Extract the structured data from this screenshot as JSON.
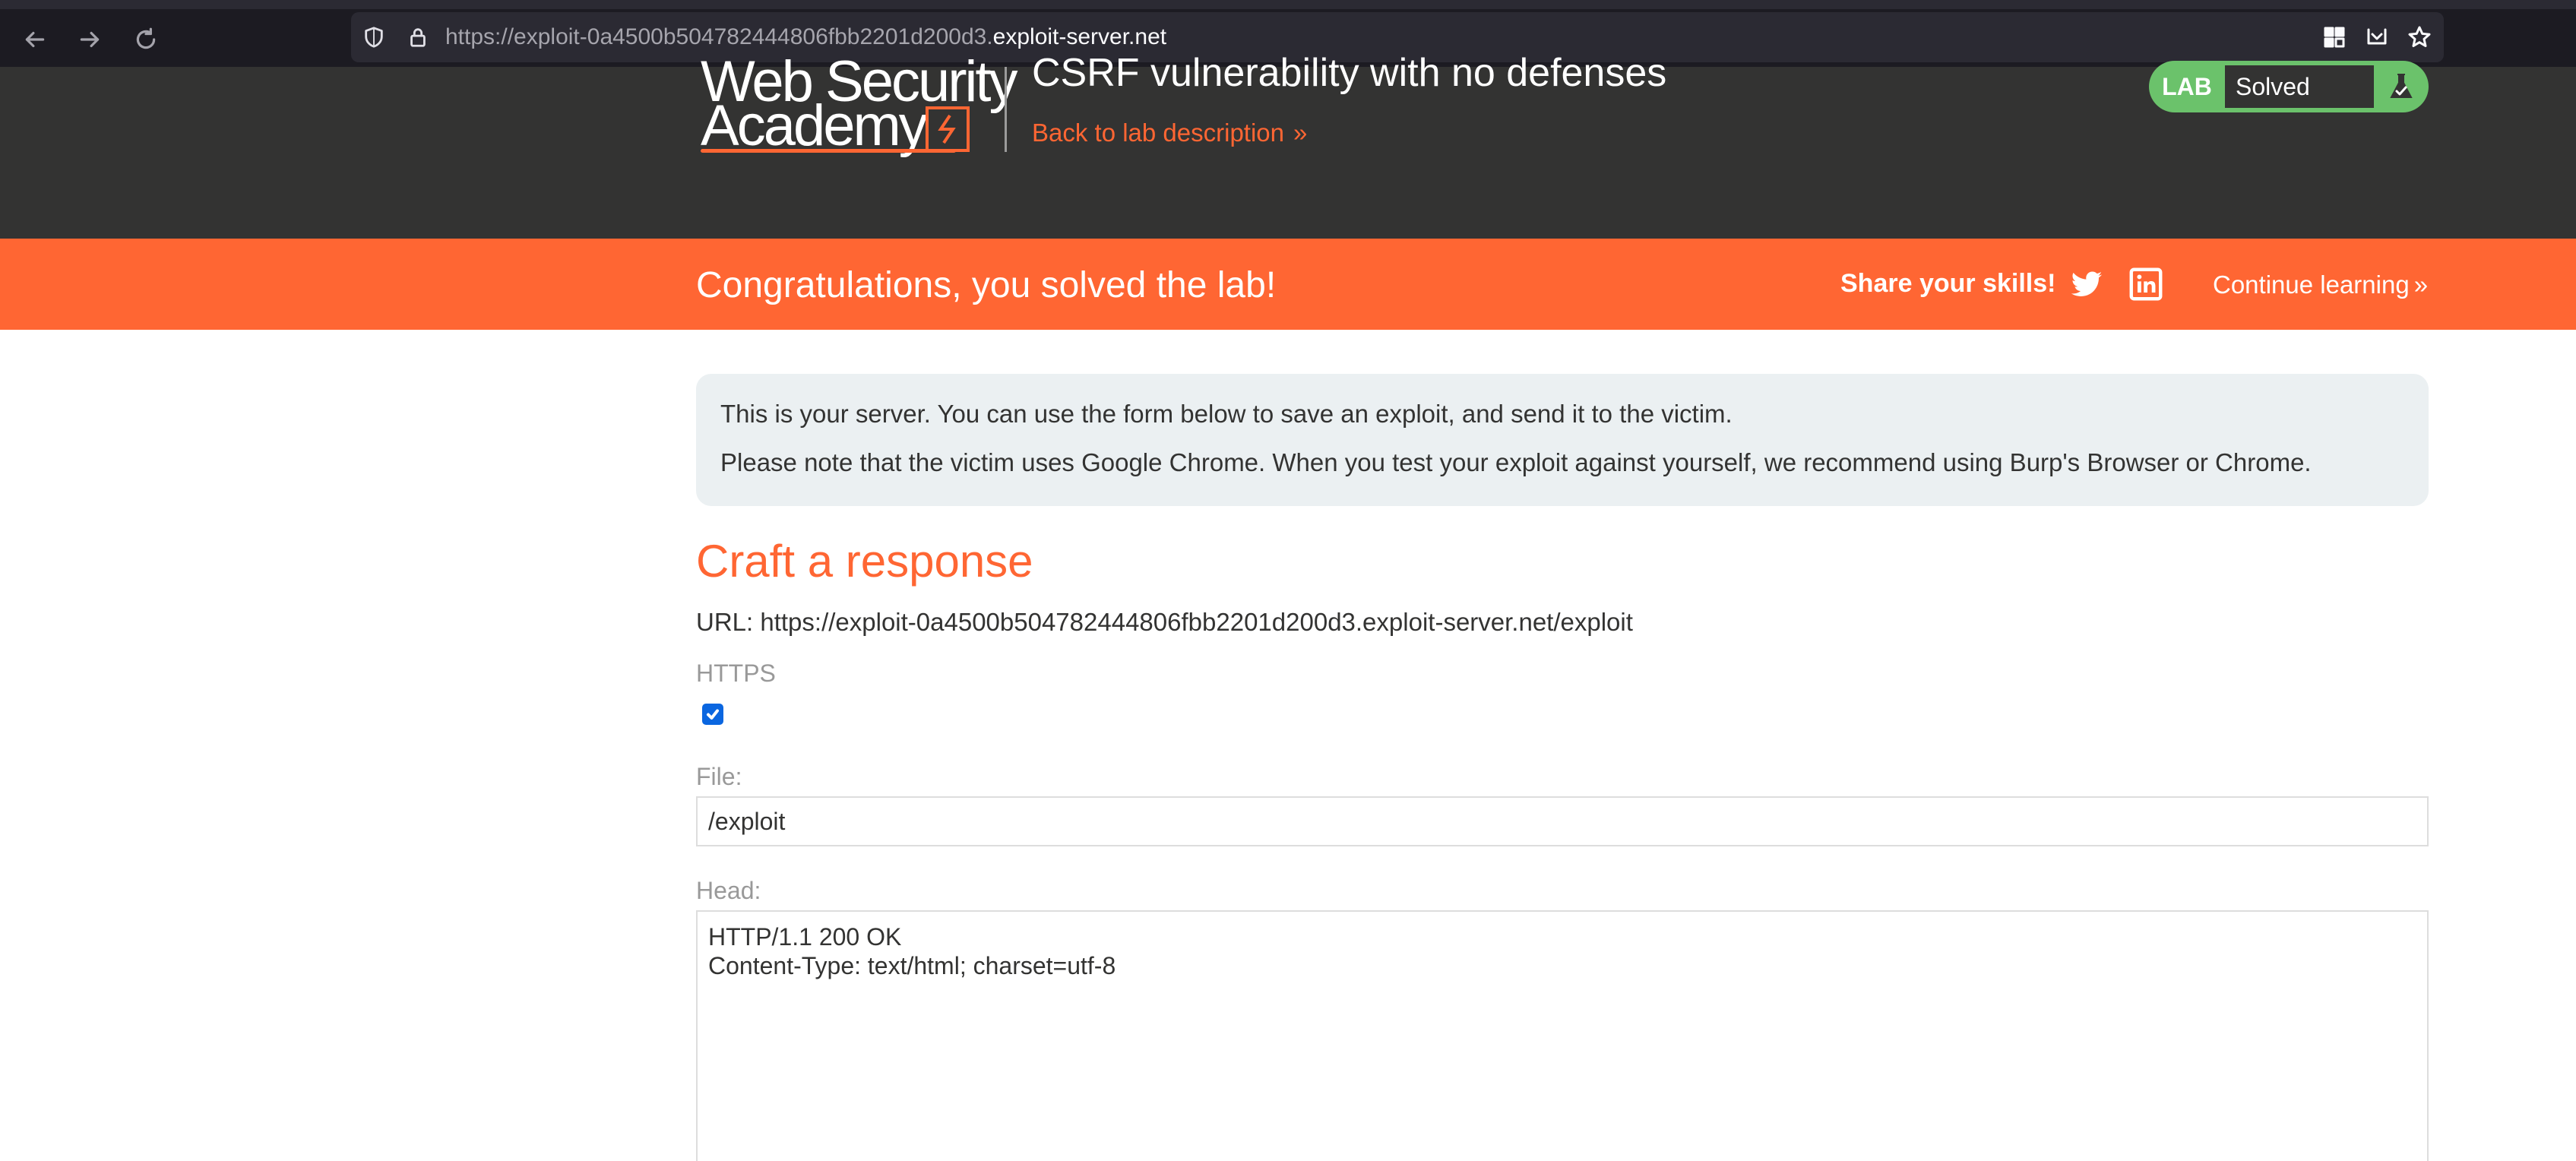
{
  "browser": {
    "url_prefix": "https://exploit-0a4500b504782444806fbb2201d200d3.",
    "url_host": "exploit-server.net",
    "icons": [
      "back-arrow-icon",
      "forward-arrow-icon",
      "reload-icon",
      "shield-icon",
      "lock-icon",
      "extensions-grid-icon",
      "save-to-pocket-icon",
      "bookmark-star-icon"
    ]
  },
  "header": {
    "logo_line1": "Web Security",
    "logo_line2": "Academy",
    "lab_title": "CSRF vulnerability with no defenses",
    "back_link": "Back to lab description",
    "back_chevron": "»",
    "status_tag": "LAB",
    "status_value": "Solved",
    "status_color": "#6bc26b"
  },
  "banner": {
    "message": "Congratulations, you solved the lab!",
    "share_label": "Share your skills!",
    "continue_link": "Continue learning",
    "continue_chevron": "»",
    "color": "#ff6633",
    "icons": [
      "twitter-icon",
      "linkedin-icon"
    ]
  },
  "main": {
    "info_line1": "This is your server. You can use the form below to save an exploit, and send it to the victim.",
    "info_line2": "Please note that the victim uses Google Chrome. When you test your exploit against yourself, we recommend using Burp's Browser or Chrome.",
    "section_title": "Craft a response",
    "url_label": "URL: https://exploit-0a4500b504782444806fbb2201d200d3.exploit-server.net/exploit",
    "https_label": "HTTPS",
    "https_checked": true,
    "file_label": "File:",
    "file_value": "/exploit",
    "head_label": "Head:",
    "head_lines": [
      "HTTP/1.1 200 OK",
      "Content-Type: text/html; charset=utf-8"
    ]
  }
}
